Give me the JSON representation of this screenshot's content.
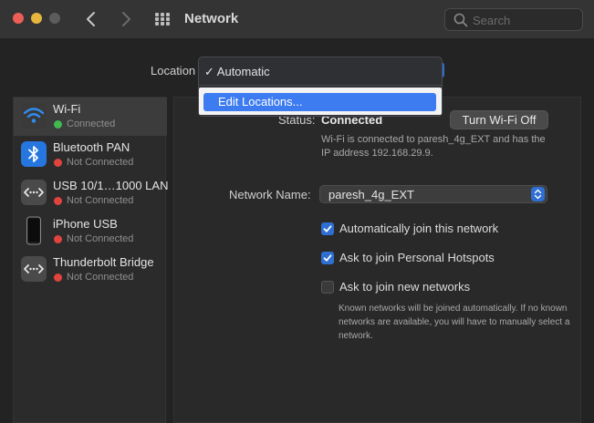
{
  "window": {
    "title": "Network"
  },
  "search": {
    "placeholder": "Search"
  },
  "location": {
    "label": "Location",
    "menu_items": [
      "✓ Automatic",
      "Edit Locations..."
    ]
  },
  "sidebar": {
    "items": [
      {
        "name": "Wi-Fi",
        "status": "Connected",
        "status_color": "#3fb950",
        "icon": "wifi-icon",
        "selected": true
      },
      {
        "name": "Bluetooth PAN",
        "status": "Not Connected",
        "status_color": "#e0443e",
        "icon": "bluetooth-icon",
        "selected": false
      },
      {
        "name": "USB 10/1…1000 LAN",
        "status": "Not Connected",
        "status_color": "#e0443e",
        "icon": "ethernet-icon",
        "selected": false
      },
      {
        "name": "iPhone USB",
        "status": "Not Connected",
        "status_color": "#e0443e",
        "icon": "iphone-icon",
        "selected": false
      },
      {
        "name": "Thunderbolt Bridge",
        "status": "Not Connected",
        "status_color": "#e0443e",
        "icon": "thunderbolt-icon",
        "selected": false
      }
    ]
  },
  "main": {
    "status_label": "Status:",
    "status_value": "Connected",
    "wifi_button": "Turn Wi-Fi Off",
    "status_desc": "Wi-Fi is connected to paresh_4g_EXT and has the IP address 192.168.29.9.",
    "network_name_label": "Network Name:",
    "network_name_value": "paresh_4g_EXT",
    "options": [
      {
        "label": "Automatically join this network",
        "checked": true
      },
      {
        "label": "Ask to join Personal Hotspots",
        "checked": true
      },
      {
        "label": "Ask to join new networks",
        "checked": false
      }
    ],
    "note": "Known networks will be joined automatically. If no known networks are available, you will have to manually select a network."
  },
  "colors": {
    "accent": "#3d7cf0",
    "connected": "#3fb950",
    "not_connected": "#e0443e"
  }
}
